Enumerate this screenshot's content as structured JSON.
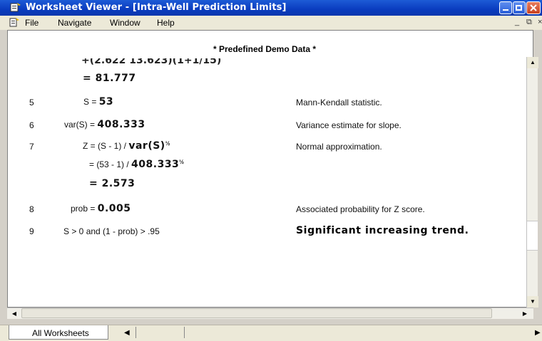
{
  "window": {
    "title": "Worksheet Viewer - [Intra-Well Prediction Limits]"
  },
  "menu": {
    "file": "File",
    "navigate": "Navigate",
    "window": "Window",
    "help": "Help"
  },
  "worksheet": {
    "header": "* Predefined Demo Data *",
    "cut_line": "+(2.622 13.623)(1+1/15)",
    "result_line": "= 81.777",
    "rows": [
      {
        "num": "5",
        "expr_prefix": "S = ",
        "expr_bold": "53",
        "desc": "Mann-Kendall statistic."
      },
      {
        "num": "6",
        "expr_prefix": "var(S) = ",
        "expr_bold": "408.333",
        "desc": "Variance estimate for slope."
      },
      {
        "num": "7",
        "expr_prefix": "Z = (S - 1) / ",
        "expr_bold": "var(S)",
        "expr_sup": "½",
        "desc": "Normal approximation."
      },
      {
        "num": "8",
        "expr_prefix": "prob = ",
        "expr_bold": "0.005",
        "desc": "Associated probability for Z score."
      },
      {
        "num": "9",
        "expr_prefix": "S > 0 and (1 - prob) > .95",
        "desc_bold": "Significant increasing trend."
      }
    ],
    "z_line2_prefix": "= (53 - 1) / ",
    "z_line2_bold": "408.333",
    "z_line2_sup": "½",
    "z_line3": "= 2.573"
  },
  "tabs": {
    "all_worksheets": "All Worksheets"
  },
  "colors": {
    "titlebar": "#0a3cbf",
    "face": "#ece9d8"
  }
}
